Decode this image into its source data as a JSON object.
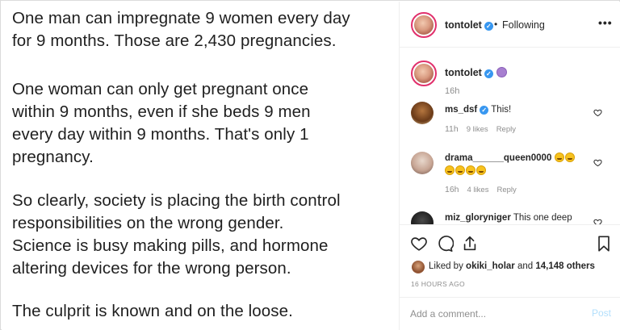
{
  "post_image": {
    "paragraphs": [
      [
        "One man can impregnate 9 women every day",
        "for 9 months. Those are 2,430 pregnancies."
      ],
      [
        "One woman can only get pregnant once",
        "within 9 months, even if she beds 9 men",
        "every day within 9 months. That's only 1",
        "pregnancy."
      ],
      [
        "So clearly, society is placing the birth control",
        "responsibilities on the wrong gender.",
        "Science is busy making pills, and hormone",
        "altering devices for the wrong person."
      ],
      [
        "The culprit is known and on the loose."
      ]
    ]
  },
  "header": {
    "username": "tontolet",
    "verified": "✓",
    "separator": "•",
    "follow_status": "Following",
    "more": "•••"
  },
  "caption": {
    "username": "tontolet",
    "verified": "✓",
    "time": "16h"
  },
  "comments": [
    {
      "username": "ms_dsf",
      "verified": "✓",
      "text": "This!",
      "time": "11h",
      "likes": "9 likes",
      "reply": "Reply"
    },
    {
      "username": "drama______queen0000",
      "emoji_count_line1": 2,
      "emoji_count_line2": 4,
      "time": "16h",
      "likes": "4 likes",
      "reply": "Reply"
    },
    {
      "username": "miz_gloryniger",
      "text": "This one deep"
    }
  ],
  "actions": {
    "liked_by_prefix": "Liked by",
    "liked_by_user": "okiki_holar",
    "liked_by_and": "and",
    "liked_by_count": "14,148 others",
    "posted_time": "16 HOURS AGO"
  },
  "add_comment": {
    "placeholder": "Add a comment...",
    "post_label": "Post"
  },
  "colors": {
    "verified_badge": "#3897f0",
    "meta_grey": "#8e8e8e",
    "post_disabled": "#b2dffc",
    "story_ring": "#e1306c"
  }
}
